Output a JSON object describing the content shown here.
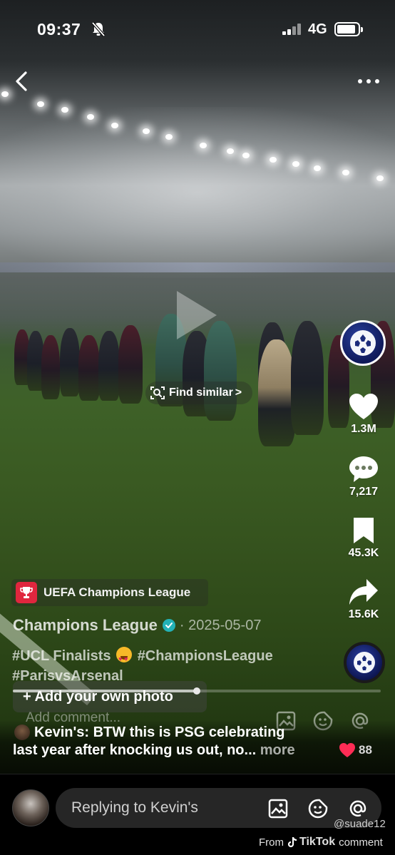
{
  "status_bar": {
    "time": "09:37",
    "network": "4G"
  },
  "find_similar": {
    "label": "Find similar",
    "chevron": ">"
  },
  "actions": {
    "likes": "1.3M",
    "comments": "7,217",
    "saves": "45.3K",
    "shares": "15.6K"
  },
  "post": {
    "sound_label": "UEFA Champions League",
    "author": "Champions League",
    "date": "· 2025-05-07",
    "hashtag_line1_a": "#UCL Finalists",
    "hashtag_line1_b": "#ChampionsLeague",
    "hashtag_line2": "#ParisvsArsenal",
    "add_photo_label": "+ Add your own photo",
    "progress_fraction": 0.5
  },
  "ghost_comment_bar": {
    "placeholder": "Add comment..."
  },
  "comment": {
    "author": "Kevin's:",
    "text_line1": "BTW this is PSG celebrating",
    "text_line2": "last year after knocking us out, no...",
    "more": "more",
    "likes": "88"
  },
  "reply_bar": {
    "placeholder": "Replying to Kevin's"
  },
  "watermark": {
    "username": "@suade12",
    "from": "From",
    "brand": "TikTok",
    "suffix": "comment"
  },
  "colors": {
    "like_red": "#fe2c55",
    "verified_blue": "#20d5ec",
    "ucl_red": "#e0263e"
  },
  "icons": [
    "chevron-left-icon",
    "more-icon",
    "find-similar-icon",
    "heart-icon",
    "comment-icon",
    "bookmark-icon",
    "share-icon",
    "image-icon",
    "sticker-icon",
    "mention-icon"
  ]
}
